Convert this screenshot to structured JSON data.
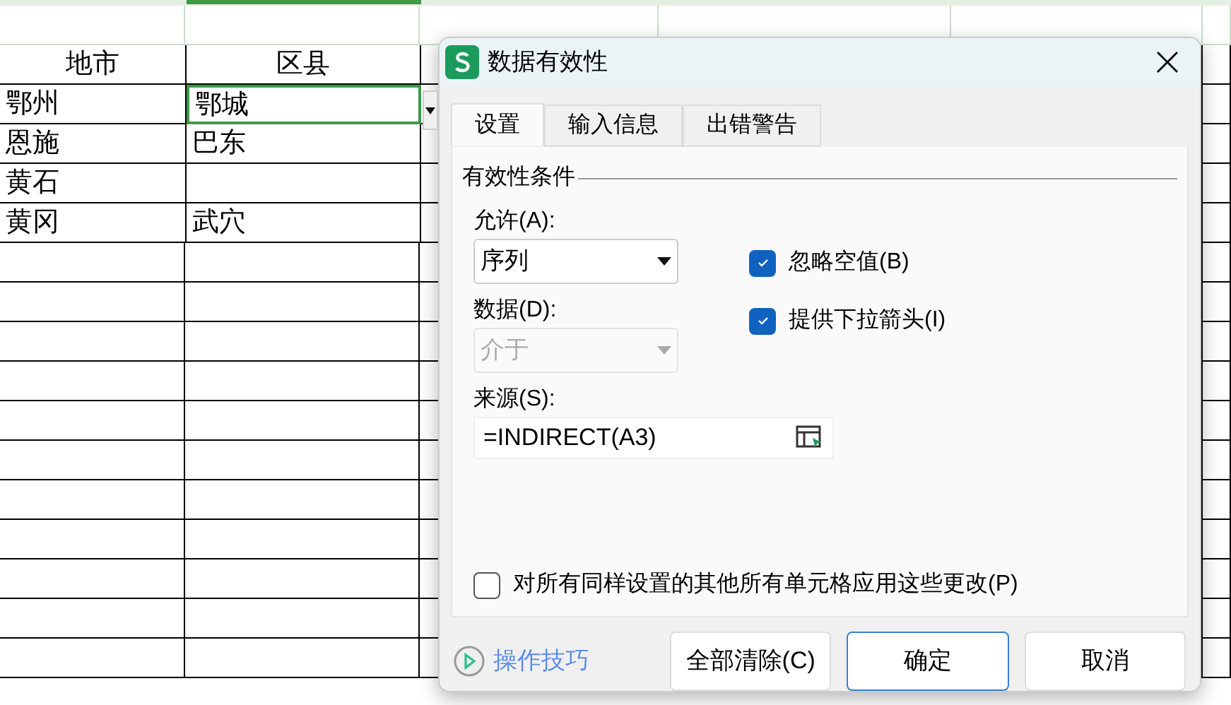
{
  "sheet": {
    "header": [
      {
        "text": "地市"
      },
      {
        "text": "区县"
      }
    ],
    "rows": [
      [
        {
          "text": "鄂州",
          "selected": false
        },
        {
          "text": "鄂城",
          "selected": true
        }
      ],
      [
        {
          "text": "恩施",
          "selected": false
        },
        {
          "text": "巴东",
          "selected": false
        }
      ],
      [
        {
          "text": "黄石",
          "selected": false
        },
        {
          "selected": false
        }
      ],
      [
        {
          "text": "黄冈",
          "selected": false
        },
        {
          "text": "武穴",
          "selected": false
        }
      ]
    ]
  },
  "dialog": {
    "title": "数据有效性",
    "tabs": [
      {
        "label": "设置",
        "selected": true
      },
      {
        "label": "输入信息",
        "selected": false
      },
      {
        "label": "出错警告",
        "selected": false
      }
    ],
    "group_title": "有效性条件",
    "allow": {
      "label": "允许(A):",
      "value": "序列",
      "disabled": false
    },
    "data": {
      "label": "数据(D):",
      "value": "介于",
      "disabled": true
    },
    "checkboxes": [
      {
        "label": "忽略空值(B)",
        "checked": true
      },
      {
        "label": "提供下拉箭头(I)",
        "checked": true
      }
    ],
    "source": {
      "label": "来源(S):",
      "value": "=INDIRECT(A3)"
    },
    "apply_all": {
      "label": "对所有同样设置的其他所有单元格应用这些更改(P)",
      "checked": false
    },
    "tips": "操作技巧",
    "buttons": [
      {
        "label": "全部清除(C)",
        "primary": false
      },
      {
        "label": "确定",
        "primary": true
      },
      {
        "label": "取消",
        "primary": false
      }
    ]
  }
}
